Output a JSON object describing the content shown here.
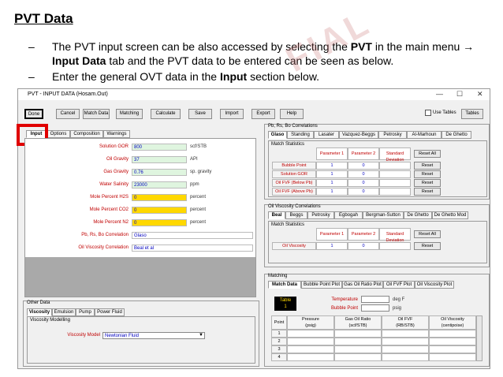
{
  "slide": {
    "title": "PVT Data",
    "bullet1_dash": "–",
    "bullet1": "The PVT input screen can be also accessed by selecting the PVT in the main menu → Input Data tab and the PVT data to be entered can be seen as below.",
    "bullet2_dash": "–",
    "bullet2": "Enter the general OVT data in the Input section below.",
    "watermark": "FIAL"
  },
  "window": {
    "title": "PVT - INPUT DATA (Hosam.Out)",
    "min": "—",
    "max": "☐",
    "close": "✕"
  },
  "toolbar": {
    "done": "Done",
    "cancel": "Cancel",
    "match_data": "Match Data",
    "matching": "Matching",
    "calculate": "Calculate",
    "save": "Save",
    "import": "Import",
    "export": "Export",
    "help": "Help",
    "use_tables": "Use Tables",
    "tables": "Tables"
  },
  "input_tabs": [
    "Input",
    "Options",
    "Composition",
    "Warnings"
  ],
  "fields": [
    {
      "label": "Solution GOR",
      "value": "800",
      "unit": "scf/STB"
    },
    {
      "label": "Oil Gravity",
      "value": "37",
      "unit": "API"
    },
    {
      "label": "Gas Gravity",
      "value": "0.76",
      "unit": "sp. gravity"
    },
    {
      "label": "Water Salinity",
      "value": "23000",
      "unit": "ppm"
    },
    {
      "label": "Mole Percent H2S",
      "value": "0",
      "unit": "percent"
    },
    {
      "label": "Mole Percent CO2",
      "value": "0",
      "unit": "percent"
    },
    {
      "label": "Mole Percent N2",
      "value": "0",
      "unit": "percent"
    },
    {
      "label": "Pb, Rs, Bo Correlation",
      "value": "Glaso",
      "unit": ""
    },
    {
      "label": "Oil Viscosity Correlation",
      "value": "Beal et al",
      "unit": ""
    }
  ],
  "other": {
    "title": "Other Data",
    "tabs": [
      "Viscosity",
      "Emulsion",
      "Pump",
      "Power Fluid"
    ],
    "group": "Viscosity Modelling",
    "model_label": "Viscosity Model",
    "model_value": "Newtonian Fluid"
  },
  "pb": {
    "title": "Pb, Rs, Bo Correlations",
    "tabs": [
      "Glaso",
      "Standing",
      "Lasater",
      "Vazquez-Beggs",
      "Petrosky",
      "Al-Marhoun",
      "De Ghetto"
    ],
    "group": "Match Statistics",
    "headers": [
      "Parameter 1",
      "Parameter 2",
      "Standard Deviation"
    ],
    "reset_all": "Reset All",
    "rows": [
      {
        "label": "Bubble Point",
        "p1": "1",
        "p2": "0",
        "btn": "Reset"
      },
      {
        "label": "Solution GOR",
        "p1": "1",
        "p2": "0",
        "btn": "Reset"
      },
      {
        "label": "Oil FVF (Below Pb)",
        "p1": "1",
        "p2": "0",
        "btn": "Reset"
      },
      {
        "label": "Oil FVF (Above Pb)",
        "p1": "1",
        "p2": "0",
        "btn": "Reset"
      }
    ]
  },
  "visc": {
    "title": "Oil Viscosity Correlations",
    "tabs": [
      "Beal",
      "Beggs",
      "Petrosky",
      "Egbogah",
      "Bergman-Sutton",
      "De Ghetto",
      "De Ghetto Mod"
    ],
    "group": "Match Statistics",
    "headers": [
      "Parameter 1",
      "Parameter 2",
      "Standard Deviation"
    ],
    "reset_all": "Reset All",
    "rows": [
      {
        "label": "Oil Viscosity",
        "p1": "1",
        "p2": "0",
        "btn": "Reset"
      }
    ]
  },
  "matching": {
    "title": "Matching",
    "tabs": [
      "Match Data",
      "Bubble Point Plot",
      "Gas Oil Ratio Plot",
      "Oil FVF Plot",
      "Oil Viscosity Plot"
    ],
    "table_label": "Table",
    "table_num": "1",
    "temp_label": "Temperature",
    "temp_unit": "deg F",
    "bp_label": "Bubble Point",
    "bp_unit": "psig",
    "col_point": "Point",
    "cols": [
      {
        "h": "Pressure",
        "u": "(psig)"
      },
      {
        "h": "Gas Oil Ratio",
        "u": "(scf/STB)"
      },
      {
        "h": "Oil FVF",
        "u": "(RB/STB)"
      },
      {
        "h": "Oil Viscosity",
        "u": "(centipoise)"
      }
    ],
    "rows": [
      "1",
      "2",
      "3",
      "4"
    ]
  },
  "colors": {
    "highlight": "#e00000",
    "yellow": "#ffd800",
    "green_input": "#dff5df"
  }
}
